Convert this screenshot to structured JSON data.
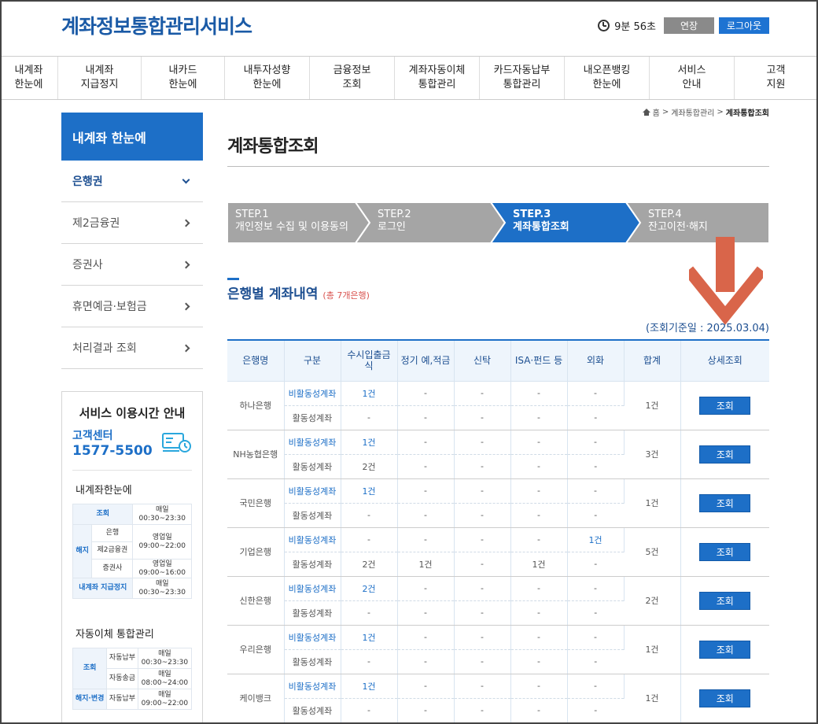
{
  "header": {
    "logo": "계좌정보통합관리서비스",
    "timer": "9분 56초",
    "extend_label": "연장",
    "logout_label": "로그아웃"
  },
  "gnb": [
    {
      "label": "내계좌\n한눈에",
      "w": 74
    },
    {
      "label": "내계좌\n지급정지",
      "w": 106
    },
    {
      "label": "내카드\n한눈에",
      "w": 106
    },
    {
      "label": "내투자성향\n한눈에",
      "w": 108
    },
    {
      "label": "금융정보\n조회",
      "w": 108
    },
    {
      "label": "계좌자동이체\n통합관리",
      "w": 108
    },
    {
      "label": "카드자동납부\n통합관리",
      "w": 108
    },
    {
      "label": "내오픈뱅킹\n한눈에",
      "w": 108
    },
    {
      "label": "서비스\n안내",
      "w": 108
    },
    {
      "label": "고객\n지원",
      "w": 106
    }
  ],
  "breadcrumb": {
    "home": "홈",
    "mid": "계좌통합관리",
    "current": "계좌통합조회"
  },
  "sidebar": {
    "title": "내계좌 한눈에",
    "items": [
      {
        "label": "은행권",
        "active": true
      },
      {
        "label": "제2금융권",
        "active": false
      },
      {
        "label": "증권사",
        "active": false
      },
      {
        "label": "휴면예금·보험금",
        "active": false
      },
      {
        "label": "처리결과 조회",
        "active": false
      }
    ]
  },
  "guide": {
    "title": "서비스 이용시간 안내",
    "cc_label": "고객센터",
    "cc_number": "1577-5500",
    "sub1": "내계좌한눈에",
    "t1": {
      "inquiry": "조회",
      "daily": "매일",
      "daily_time": "00:30~23:30",
      "cancel": "해지",
      "bank": "은행",
      "fin2": "제2금융권",
      "sec": "증권사",
      "biz": "영업일",
      "biz_time1": "09:00~22:00",
      "biz_time2": "09:00~16:00",
      "stop": "내계좌 지급정지",
      "stop_daily": "매일",
      "stop_time": "00:30~23:30"
    },
    "sub2": "자동이체 통합관리",
    "t2": {
      "inquiry": "조회",
      "auto_pay": "자동납부",
      "daily1": "매일",
      "time1": "00:30~23:30",
      "auto_send": "자동송금",
      "daily2": "매일",
      "time2": "08:00~24:00",
      "cancel": "해지·변경",
      "auto_pay2": "자동납부",
      "daily3": "매일",
      "time3": "09:00~22:00"
    }
  },
  "page": {
    "title": "계좌통합조회"
  },
  "steps": [
    {
      "num": "STEP.1",
      "label": "개인정보 수집 및 이용동의",
      "active": false
    },
    {
      "num": "STEP.2",
      "label": "로그인",
      "active": false
    },
    {
      "num": "STEP.3",
      "label": "계좌통합조회",
      "active": true
    },
    {
      "num": "STEP.4",
      "label": "잔고이전·해지",
      "active": false
    }
  ],
  "section": {
    "title": "은행별 계좌내역",
    "count": "(총 7개은행)",
    "base_date": "(조회기준일 : 2025.03.04)"
  },
  "table": {
    "headers": [
      "은행명",
      "구분",
      "수시입출금식",
      "정기 예,적금",
      "신탁",
      "ISA·펀드 등",
      "외화",
      "합계",
      "상세조회"
    ],
    "rows": [
      {
        "bank": "하나은행",
        "total": "1건",
        "button": "조회",
        "sub": [
          {
            "type": "비활동성계좌",
            "vals": [
              "1건",
              "-",
              "-",
              "-",
              "-"
            ]
          },
          {
            "type": "활동성계좌",
            "vals": [
              "-",
              "-",
              "-",
              "-",
              "-"
            ]
          }
        ]
      },
      {
        "bank": "NH농협은행",
        "total": "3건",
        "button": "조회",
        "sub": [
          {
            "type": "비활동성계좌",
            "vals": [
              "1건",
              "-",
              "-",
              "-",
              "-"
            ]
          },
          {
            "type": "활동성계좌",
            "vals": [
              "2건",
              "-",
              "-",
              "-",
              "-"
            ]
          }
        ]
      },
      {
        "bank": "국민은행",
        "total": "1건",
        "button": "조회",
        "sub": [
          {
            "type": "비활동성계좌",
            "vals": [
              "1건",
              "-",
              "-",
              "-",
              "-"
            ]
          },
          {
            "type": "활동성계좌",
            "vals": [
              "-",
              "-",
              "-",
              "-",
              "-"
            ]
          }
        ]
      },
      {
        "bank": "기업은행",
        "total": "5건",
        "button": "조회",
        "sub": [
          {
            "type": "비활동성계좌",
            "vals": [
              "-",
              "-",
              "-",
              "-",
              "1건"
            ]
          },
          {
            "type": "활동성계좌",
            "vals": [
              "2건",
              "1건",
              "-",
              "1건",
              "-"
            ]
          }
        ]
      },
      {
        "bank": "신한은행",
        "total": "2건",
        "button": "조회",
        "sub": [
          {
            "type": "비활동성계좌",
            "vals": [
              "2건",
              "-",
              "-",
              "-",
              "-"
            ]
          },
          {
            "type": "활동성계좌",
            "vals": [
              "-",
              "-",
              "-",
              "-",
              "-"
            ]
          }
        ]
      },
      {
        "bank": "우리은행",
        "total": "1건",
        "button": "조회",
        "sub": [
          {
            "type": "비활동성계좌",
            "vals": [
              "1건",
              "-",
              "-",
              "-",
              "-"
            ]
          },
          {
            "type": "활동성계좌",
            "vals": [
              "-",
              "-",
              "-",
              "-",
              "-"
            ]
          }
        ]
      },
      {
        "bank": "케이뱅크",
        "total": "1건",
        "button": "조회",
        "sub": [
          {
            "type": "비활동성계좌",
            "vals": [
              "1건",
              "-",
              "-",
              "-",
              "-"
            ]
          },
          {
            "type": "활동성계좌",
            "vals": [
              "-",
              "-",
              "-",
              "-",
              "-"
            ]
          }
        ]
      }
    ]
  },
  "colors": {
    "primary": "#1d6fc7",
    "step_inactive": "#a5a5a5",
    "annotation_arrow": "#d9654a"
  }
}
